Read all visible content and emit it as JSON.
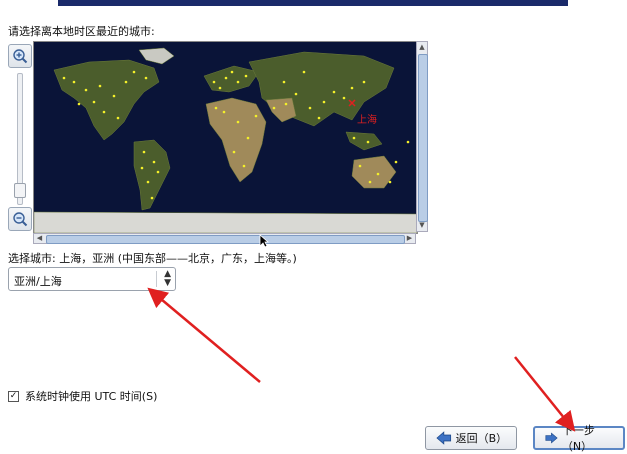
{
  "prompt": "请选择离本地时区最近的城市:",
  "zoom_in_icon": "zoom-in-icon",
  "zoom_out_icon": "zoom-out-icon",
  "map": {
    "selected_label": "上海"
  },
  "selection": {
    "text": "选择城市: 上海，亚洲 (中国东部——北京，广东，上海等。)"
  },
  "city_select": {
    "value": "亚洲/上海"
  },
  "utc": {
    "label": "系统时钟使用 UTC 时间(S)",
    "checked": true
  },
  "buttons": {
    "back": "返回（B）",
    "next": "下一步（N）"
  },
  "colors": {
    "accent": "#1e5ca8",
    "annotation": "#e02020",
    "city_dot": "#f4f02a",
    "ocean": "#0a1438"
  }
}
